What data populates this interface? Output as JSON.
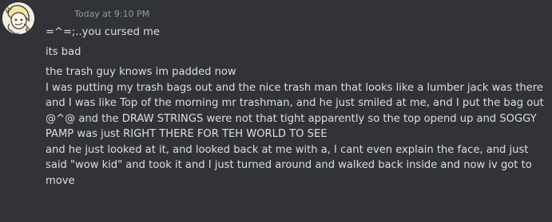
{
  "timestamp": "Today at 9:10 PM",
  "messages": [
    "=^=;..you cursed me",
    "its bad",
    "the trash guy knows im padded now",
    "I was putting my trash bags out and the nice trash man that looks like a lumber jack was there and I was like Top of the morning mr trashman, and he just smiled at me, and I put the bag out @^@ and the DRAW STRINGS were not that tight apparently so the top opend up and SOGGY PAMP was just RIGHT THERE FOR TEH WORLD TO SEE",
    "and he just looked at it, and looked back at me with a, I cant even explain the face, and just said \"wow kid\" and took it and I just turned around and walked back inside and now iv got to",
    "move"
  ]
}
